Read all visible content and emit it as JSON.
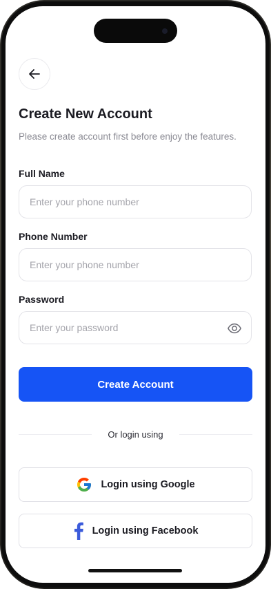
{
  "colors": {
    "primary": "#1654f5",
    "text": "#1b1b22",
    "muted": "#8a8a93",
    "border": "#e3e3e8"
  },
  "header": {
    "back_icon": "arrow-left-icon",
    "title": "Create New Account",
    "subtitle": "Please create account first before enjoy the features."
  },
  "form": {
    "full_name": {
      "label": "Full Name",
      "placeholder": "Enter your phone number",
      "value": ""
    },
    "phone": {
      "label": "Phone Number",
      "placeholder": "Enter your phone number",
      "value": ""
    },
    "password": {
      "label": "Password",
      "placeholder": "Enter your password",
      "value": "",
      "toggle_icon": "eye-icon"
    }
  },
  "actions": {
    "create_account": "Create Account",
    "divider_text": "Or login using",
    "google": {
      "label": "Login using Google",
      "icon": "google-icon"
    },
    "facebook": {
      "label": "Login using Facebook",
      "icon": "facebook-icon"
    }
  }
}
